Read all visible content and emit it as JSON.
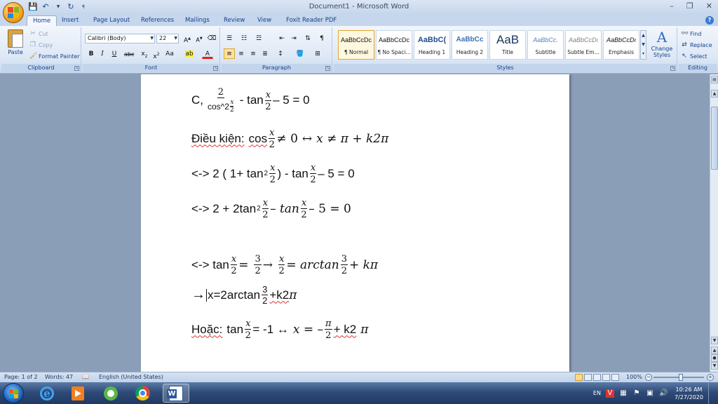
{
  "window": {
    "title": "Document1 - Microsoft Word",
    "controls": [
      "–",
      "❐",
      "✕"
    ]
  },
  "qat": {
    "save_icon": "save-icon",
    "undo_icon": "undo-icon",
    "redo_icon": "redo-icon"
  },
  "tabs": [
    "Home",
    "Insert",
    "Page Layout",
    "References",
    "Mailings",
    "Review",
    "View",
    "Foxit Reader PDF"
  ],
  "clipboard": {
    "paste": "Paste",
    "cut": "Cut",
    "copy": "Copy",
    "format_painter": "Format Painter",
    "label": "Clipboard"
  },
  "font": {
    "name": "Calibri (Body)",
    "size": "22",
    "label": "Font"
  },
  "paragraph": {
    "label": "Paragraph"
  },
  "styles": {
    "label": "Styles",
    "items": [
      {
        "sample": "AaBbCcDc",
        "name": "¶ Normal"
      },
      {
        "sample": "AaBbCcDc",
        "name": "¶ No Spaci..."
      },
      {
        "sample": "AaBbC(",
        "name": "Heading 1"
      },
      {
        "sample": "AaBbCc",
        "name": "Heading 2"
      },
      {
        "sample": "AaB",
        "name": "Title"
      },
      {
        "sample": "AaBbCc.",
        "name": "Subtitle"
      },
      {
        "sample": "AaBbCcDı",
        "name": "Subtle Em..."
      },
      {
        "sample": "AaBbCcDı",
        "name": "Emphasis"
      }
    ],
    "change_styles": "Change Styles"
  },
  "editing": {
    "find": "Find",
    "replace": "Replace",
    "select": "Select",
    "label": "Editing"
  },
  "doc": {
    "l1": {
      "prefix": "C,",
      "num": "2",
      "den_pre": "cos^2",
      "den_frac_num": "x",
      "den_frac_den": "2",
      "mid": "- tan",
      "fx": "x",
      "fd": "2",
      "rest": "– 5 = 0"
    },
    "l2": {
      "word": "Điều kiện:",
      "cos": "cos",
      "fx": "x",
      "fd": "2",
      "rest1": "≠ 0",
      "arrow": "↔",
      "rest2": "x ≠  π + k2π"
    },
    "l3": {
      "prefix": "<-> 2 ( 1+ tan",
      "exp": "2",
      "fx": "x",
      "fd": "2",
      "mid": ")  - tan",
      "gx": "x",
      "gd": "2",
      "rest": "– 5 = 0"
    },
    "l4": {
      "prefix": "<-> 2 + 2tan",
      "exp": "2",
      "fx": "x",
      "fd": "2",
      "mid": "–  tan",
      "gx": "x",
      "gd": "2",
      "rest": "–  5 = 0"
    },
    "l5": {
      "prefix": "<-> tan",
      "fx": "x",
      "fd": "2",
      "eq": "=",
      "hn": "3",
      "hd": "2",
      "arrow": "→",
      "gx": "x",
      "gd": "2",
      "mid": "= arctan",
      "in": "3",
      "id": "2",
      "rest": "+ kπ"
    },
    "l6": {
      "arrow": "→",
      "text": "x=2arctan",
      "fn": "3",
      "fd": "2",
      "rest1": "+k2",
      "rest2": "π"
    },
    "l7": {
      "word": "Hoặc:",
      "tan": "tan",
      "fx": "x",
      "fd": "2",
      "mid": "= -1 ↔",
      "eq": "x =  –",
      "pn": "π",
      "pd": "2",
      "rest1": "+ k2",
      "rest2": "π"
    }
  },
  "status": {
    "page": "Page: 1 of 2",
    "words": "Words: 47",
    "language": "English (United States)",
    "zoom": "100%"
  },
  "taskbar": {
    "lang": "EN",
    "time": "10:26 AM",
    "date": "7/27/2020"
  }
}
